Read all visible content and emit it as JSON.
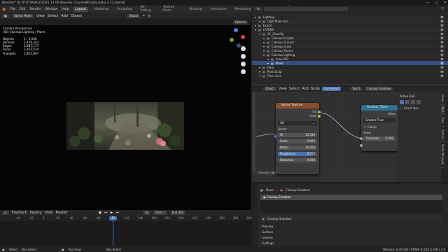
{
  "window": {
    "title": "Blender* [D:\\TUTORIALS\\2021 11 06 Blender Course\\BC\\dzbushka 2 12.blend]",
    "buttons": [
      "—",
      "□",
      "✕"
    ]
  },
  "menubar": {
    "items": [
      "File",
      "Edit",
      "Render",
      "Window",
      "Help"
    ],
    "workspaces": [
      "Layout",
      "Modeling",
      "Sculpting",
      "UV Editing",
      "Texture Paint",
      "Shading",
      "Animation",
      "Rendering",
      "Compositing",
      "Geometry Nodes",
      "Scripting"
    ],
    "active_workspace": "Layout",
    "scene_label": "Scene",
    "viewlayer_label": "V1_Closeup"
  },
  "viewport": {
    "mode": "Object Mode",
    "menus": [
      "View",
      "Select",
      "Add",
      "Object"
    ],
    "transform": "Global",
    "options": "Options",
    "overlay_title": "Camera Perspective",
    "overlay_subtitle": "(42) Closeup Lighting | Plane",
    "stats": [
      {
        "label": "Objects",
        "value": "1 / 3,640"
      },
      {
        "label": "Vertices",
        "value": "1,436,342"
      },
      {
        "label": "Edges",
        "value": "2,887,177"
      },
      {
        "label": "Faces",
        "value": "1,452,514"
      },
      {
        "label": "Triangles",
        "value": "2,855,097"
      }
    ]
  },
  "outliner": {
    "search_placeholder": "",
    "rows": [
      {
        "label": "Lighting",
        "indent": 0
      },
      {
        "label": "Light Main Sun",
        "indent": 1
      },
      {
        "label": "Export",
        "indent": 0
      },
      {
        "label": "LAYERS",
        "indent": 0
      },
      {
        "label": "V1_CloseUp",
        "indent": 1
      },
      {
        "label": "Closeup Sculpts",
        "indent": 2
      },
      {
        "label": "Closeup Ground",
        "indent": 2
      },
      {
        "label": "Closeup Grass",
        "indent": 2
      },
      {
        "label": "Closeup Stones",
        "indent": 2
      },
      {
        "label": "Closeup Lighting",
        "indent": 2
      },
      {
        "label": "Area.002",
        "indent": 3
      },
      {
        "label": "Plane",
        "indent": 3
      },
      {
        "label": "Hero",
        "indent": 1
      },
      {
        "label": "Post Sculp",
        "indent": 1
      },
      {
        "label": "Tree Lines",
        "indent": 1
      }
    ],
    "selected": "Plane"
  },
  "node_editor": {
    "type": "Object",
    "menus": [
      "View",
      "Select",
      "Add",
      "Node"
    ],
    "use_nodes": "Use Nodes",
    "slot": "Slot 1",
    "material": "Closeup Shadows",
    "noise_node": {
      "title": "Noise Texture",
      "out_fac": "Fac",
      "out_color": "Color",
      "dimensions": "4D",
      "vector": "Vector",
      "fields": [
        {
          "label": "W",
          "value": "14.330"
        },
        {
          "label": "Scale",
          "value": "0.660"
        },
        {
          "label": "Detail",
          "value": "16.000"
        },
        {
          "label": "Roughness",
          "value": "0.917"
        },
        {
          "label": "Distortion",
          "value": "0.000"
        }
      ]
    },
    "math_node": {
      "title": "Greater Than",
      "out_value": "Value",
      "operation": "Greater Than",
      "clamp": "Clamp",
      "in_value": "Value",
      "threshold_label": "Threshold",
      "threshold_value": "0.500"
    },
    "frame_label": "Closeup Light",
    "sidepanel": {
      "title": "Active Tool",
      "tool": "Select Box",
      "tabs": [
        "Node",
        "Tool",
        "View",
        "Options",
        "Node Wrangler"
      ]
    }
  },
  "properties": {
    "object": "Plane",
    "material": "Closeup Shadows",
    "slot_label": "Closeup Shadows",
    "mat_name": "Closeup Shadows",
    "sections": [
      "Preview",
      "Surface",
      "Volume",
      "Settings"
    ]
  },
  "timeline": {
    "menus": [
      "Playback",
      "Keying",
      "View",
      "Marker"
    ],
    "current_frame": "42",
    "start_label": "Start",
    "start": "1",
    "end_label": "End",
    "end": "300",
    "ticks": [
      "-40",
      "-20",
      "0",
      "20",
      "40",
      "60",
      "80",
      "100",
      "120",
      "140",
      "160",
      "180",
      "200",
      "220",
      "240",
      "260",
      "280",
      "300"
    ]
  },
  "statusbar": {
    "left": [
      "Select",
      "Box Select",
      "Pan View",
      "Box Select"
    ],
    "right": "Memory: 6.35 GiB | VRAM: 6.2/11.0 GiB | 3.0"
  },
  "colors": {
    "accent_blue": "#4772b3",
    "noise_header": "#8a4d2a",
    "math_header": "#2f6f8f",
    "frame_marker": "#3b7bd6"
  }
}
